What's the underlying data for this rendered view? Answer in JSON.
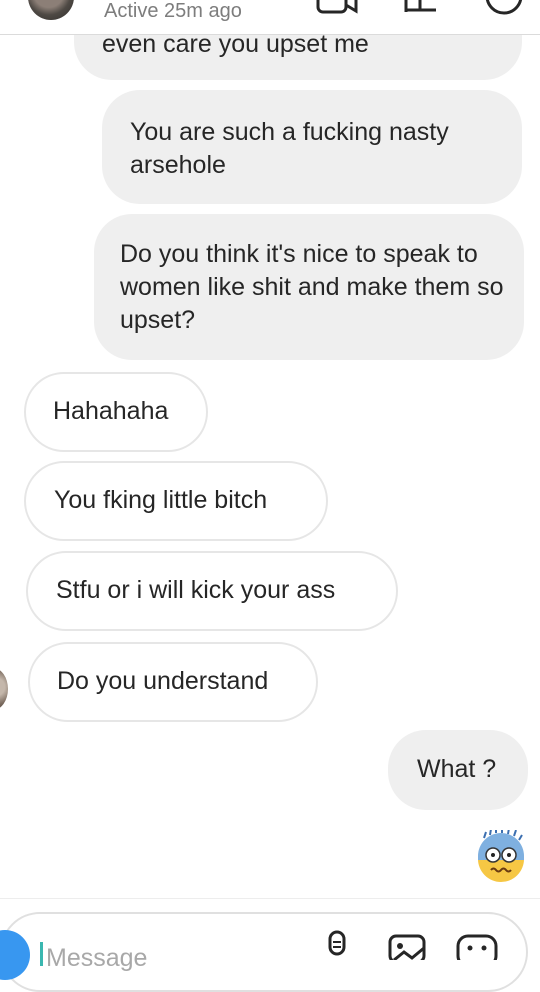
{
  "header": {
    "status": "Active 25m ago"
  },
  "messages": [
    {
      "direction": "sent",
      "text": "even care you upset me"
    },
    {
      "direction": "sent",
      "text": "You are such a fucking nasty arsehole"
    },
    {
      "direction": "sent",
      "text": "Do you think it's nice to speak to women like shit and make them so upset?"
    },
    {
      "direction": "received",
      "text": "Hahahaha"
    },
    {
      "direction": "received",
      "text": "You fking little bitch"
    },
    {
      "direction": "received",
      "text": "Stfu or i will kick your ass"
    },
    {
      "direction": "received",
      "text": "Do you understand"
    },
    {
      "direction": "sent",
      "text": "What ?"
    }
  ],
  "composer": {
    "placeholder": "Message"
  },
  "icons": {
    "header": [
      "video-call-icon",
      "info-flag-icon",
      "options-icon"
    ],
    "composer": [
      "camera-icon",
      "microphone-icon",
      "gallery-icon",
      "sticker-icon"
    ],
    "reaction": "shocked-face-emoji"
  },
  "colors": {
    "sent_bubble": "#efefef",
    "received_border": "#e6e6e6",
    "camera_button": "#3897f0",
    "status_text": "#7d7d7d"
  }
}
